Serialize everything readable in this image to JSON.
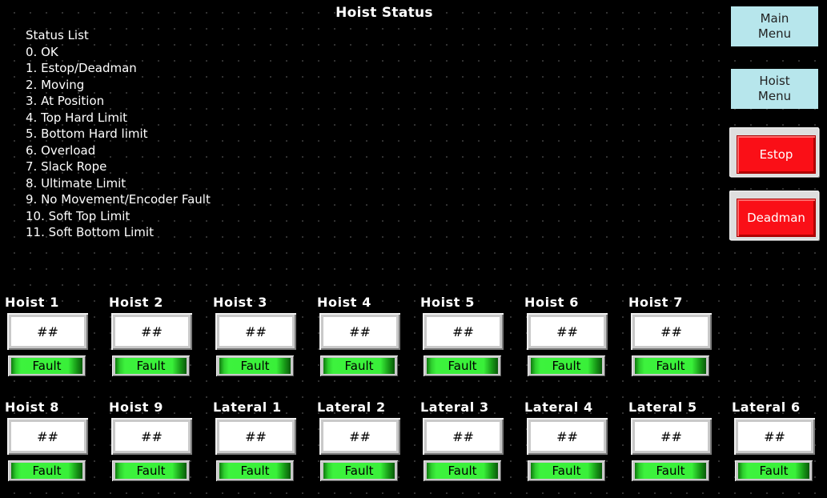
{
  "header": {
    "title": "Hoist Status"
  },
  "status_list": {
    "heading": "Status List",
    "items": [
      "0. OK",
      "1. Estop/Deadman",
      "2. Moving",
      "3. At Position",
      "4. Top Hard Limit",
      "5. Bottom Hard limit",
      "6. Overload",
      "7. Slack Rope",
      "8. Ultimate Limit",
      "9. No Movement/Encoder Fault",
      "10. Soft Top Limit",
      "11. Soft Bottom Limit"
    ]
  },
  "nav": {
    "main_menu": "Main\nMenu",
    "hoist_menu": "Hoist\nMenu"
  },
  "controls": {
    "estop": "Estop",
    "deadman": "Deadman"
  },
  "units_row1": [
    {
      "label": "Hoist 1",
      "value": "##",
      "fault": "Fault"
    },
    {
      "label": "Hoist 2",
      "value": "##",
      "fault": "Fault"
    },
    {
      "label": "Hoist 3",
      "value": "##",
      "fault": "Fault"
    },
    {
      "label": "Hoist 4",
      "value": "##",
      "fault": "Fault"
    },
    {
      "label": "Hoist 5",
      "value": "##",
      "fault": "Fault"
    },
    {
      "label": "Hoist 6",
      "value": "##",
      "fault": "Fault"
    },
    {
      "label": "Hoist 7",
      "value": "##",
      "fault": "Fault"
    }
  ],
  "units_row2": [
    {
      "label": "Hoist 8",
      "value": "##",
      "fault": "Fault"
    },
    {
      "label": "Hoist 9",
      "value": "##",
      "fault": "Fault"
    },
    {
      "label": "Lateral 1",
      "value": "##",
      "fault": "Fault"
    },
    {
      "label": "Lateral 2",
      "value": "##",
      "fault": "Fault"
    },
    {
      "label": "Lateral 3",
      "value": "##",
      "fault": "Fault"
    },
    {
      "label": "Lateral 4",
      "value": "##",
      "fault": "Fault"
    },
    {
      "label": "Lateral 5",
      "value": "##",
      "fault": "Fault"
    },
    {
      "label": "Lateral 6",
      "value": "##",
      "fault": "Fault"
    }
  ],
  "colors": {
    "background": "#000000",
    "nav_button": "#b7e6ec",
    "estop_red": "#fa0f17",
    "fault_lamp_green": "#39f039"
  }
}
